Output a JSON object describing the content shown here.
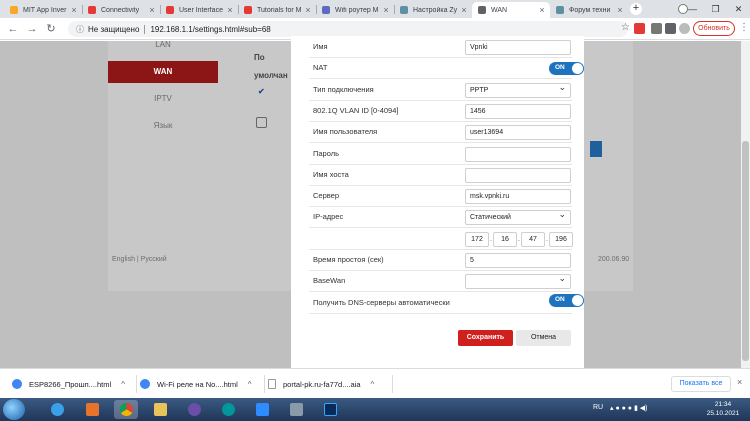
{
  "browser": {
    "tabs": [
      {
        "title": "MIT App Inver",
        "color": "#f9a825"
      },
      {
        "title": "Connectivity",
        "color": "#e53935"
      },
      {
        "title": "User Interface",
        "color": "#e53935"
      },
      {
        "title": "Tutorials for M",
        "color": "#e53935"
      },
      {
        "title": "Wifi роутер M",
        "color": "#5c6bc0"
      },
      {
        "title": "Настройка Zy",
        "color": "#5f8fa3"
      },
      {
        "title": "WAN",
        "color": "#5f6368"
      },
      {
        "title": "Форум техни",
        "color": "#5f8fa3"
      }
    ],
    "new_tab": "+",
    "window_controls": {
      "minimize": "—",
      "maximize": "❐",
      "close": "✕"
    },
    "address": {
      "security": "Не защищено",
      "url": "192.168.1.1/settings.html#sub=68"
    },
    "update_label": "Обновить",
    "tab_close": "×"
  },
  "background_page": {
    "sidebar": [
      {
        "label": "LAN",
        "active": false
      },
      {
        "label": "WAN",
        "active": true
      },
      {
        "label": "IPTV",
        "active": false
      },
      {
        "label": "Язык",
        "active": false
      }
    ],
    "text_fragments": [
      "По",
      "умолчан"
    ],
    "footer_left": "English | Русский",
    "footer_right": "200.06.90"
  },
  "modal": {
    "fields": [
      {
        "label": "Имя",
        "type": "text",
        "value": "Vpnki"
      },
      {
        "label": "NAT",
        "type": "toggle",
        "value": "ON"
      },
      {
        "label": "Тип подключения",
        "type": "select",
        "value": "PPTP"
      },
      {
        "label": "802.1Q VLAN ID [0-4094]",
        "type": "text",
        "value": "1456"
      },
      {
        "label": "Имя пользователя",
        "type": "text",
        "value": "user13694"
      },
      {
        "label": "Пароль",
        "type": "text",
        "value": ""
      },
      {
        "label": "Имя хоста",
        "type": "text",
        "value": ""
      },
      {
        "label": "Сервер",
        "type": "text",
        "value": "msk.vpnki.ru"
      },
      {
        "label": "IP-адрес",
        "type": "select",
        "value": "Статический"
      },
      {
        "label": "",
        "type": "ip",
        "value": [
          "172",
          "16",
          "47",
          "196"
        ]
      },
      {
        "label": "Время простоя (сек)",
        "type": "text",
        "value": "5"
      },
      {
        "label": "BaseWan",
        "type": "select",
        "value": ""
      },
      {
        "label": "Получить DNS-серверы автоматически",
        "type": "toggle",
        "value": "ON"
      }
    ],
    "save_label": "Сохранить",
    "cancel_label": "Отмена"
  },
  "downloads": {
    "items": [
      {
        "name": "ESP8266_Прошп....html",
        "icon_color": "#4285f4"
      },
      {
        "name": "Wi-Fi реле на No....html",
        "icon_color": "#4285f4"
      },
      {
        "name": "portal-pk.ru-fa77d....aia",
        "icon_color": "file"
      }
    ],
    "show_all_label": "Показать все",
    "close": "×"
  },
  "taskbar": {
    "language": "RU",
    "time": "21:34",
    "date": "25.10.2021"
  }
}
